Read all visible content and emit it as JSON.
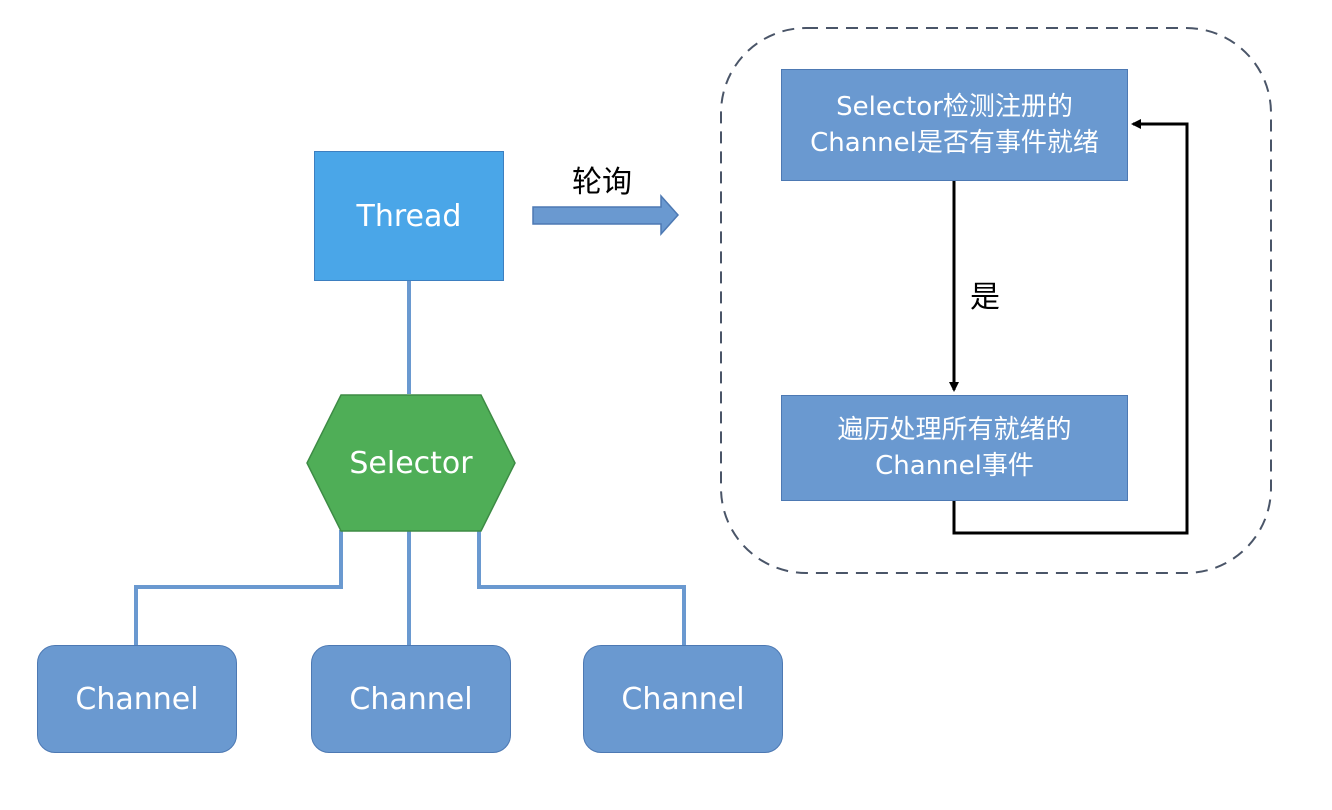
{
  "thread": {
    "label": "Thread"
  },
  "selector": {
    "label": "Selector"
  },
  "channels": [
    {
      "label": "Channel"
    },
    {
      "label": "Channel"
    },
    {
      "label": "Channel"
    }
  ],
  "poll": {
    "label": "轮询"
  },
  "loop": {
    "check": {
      "line1": "Selector检测注册的",
      "line2": "Channel是否有事件就绪"
    },
    "yes_label": "是",
    "process": {
      "line1": "遍历处理所有就绪的",
      "line2": "Channel事件"
    }
  },
  "colors": {
    "thread_fill": "#4aa6e8",
    "selector_fill": "#4fae57",
    "box_fill": "#6a99d0",
    "connector": "#6a99d0",
    "arrow": "#000000",
    "dashed_border": "#4a5568"
  }
}
